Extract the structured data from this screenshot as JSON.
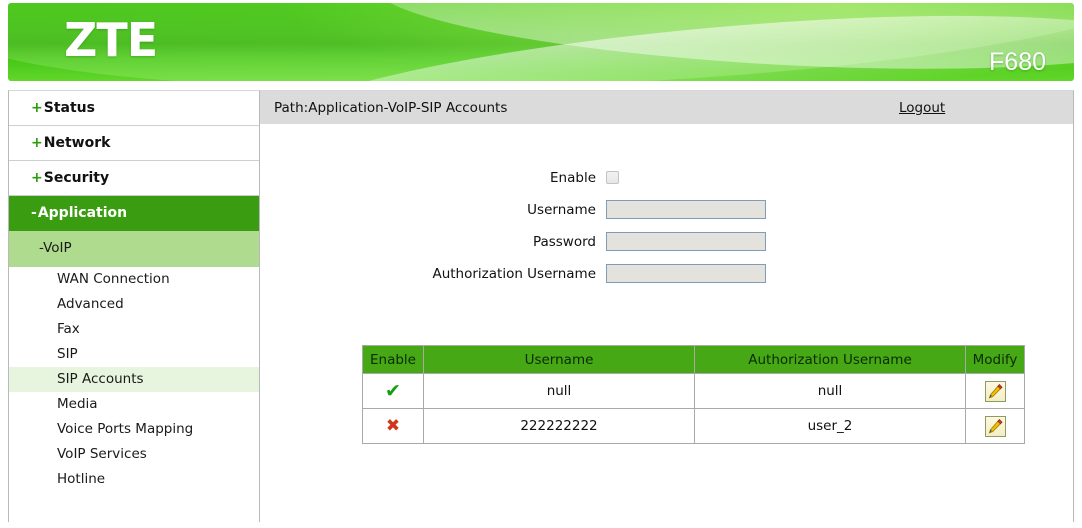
{
  "header": {
    "brand": "ZTE",
    "model": "F680",
    "brand_color": "#ffffff",
    "banner_green": "#35b708"
  },
  "sidebar": {
    "top_items": [
      {
        "sign": "+",
        "label": "Status",
        "active": false
      },
      {
        "sign": "+",
        "label": "Network",
        "active": false
      },
      {
        "sign": "+",
        "label": "Security",
        "active": false
      },
      {
        "sign": "-",
        "label": "Application",
        "active": true
      }
    ],
    "sub_item": {
      "sign": "-",
      "label": "VoIP"
    },
    "leaf_items": [
      {
        "label": "WAN Connection",
        "selected": false
      },
      {
        "label": "Advanced",
        "selected": false
      },
      {
        "label": "Fax",
        "selected": false
      },
      {
        "label": "SIP",
        "selected": false
      },
      {
        "label": "SIP Accounts",
        "selected": true
      },
      {
        "label": "Media",
        "selected": false
      },
      {
        "label": "Voice Ports Mapping",
        "selected": false
      },
      {
        "label": "VoIP Services",
        "selected": false
      },
      {
        "label": "Hotline",
        "selected": false
      }
    ],
    "active_color": "#3a9c10",
    "sub_color": "#aedb8d",
    "selected_color": "#e8f5de"
  },
  "content": {
    "path": "Path:Application-VoIP-SIP Accounts",
    "logout": "Logout"
  },
  "form": {
    "enable_label": "Enable",
    "enable_checked": false,
    "fields": [
      {
        "label": "Username",
        "value": "",
        "placeholder": ""
      },
      {
        "label": "Password",
        "value": "",
        "placeholder": ""
      },
      {
        "label": "Authorization Username",
        "value": "",
        "placeholder": ""
      }
    ]
  },
  "table": {
    "headers": [
      "Enable",
      "Username",
      "Authorization Username",
      "Modify"
    ],
    "header_color": "#45a814",
    "rows": [
      {
        "enable": "✔",
        "enable_state": "enabled",
        "username": "null",
        "auth_username": "null",
        "modify": "edit-icon"
      },
      {
        "enable": "✖",
        "enable_state": "disabled",
        "username": "222222222",
        "auth_username": "user_2",
        "modify": "edit-icon"
      }
    ]
  }
}
